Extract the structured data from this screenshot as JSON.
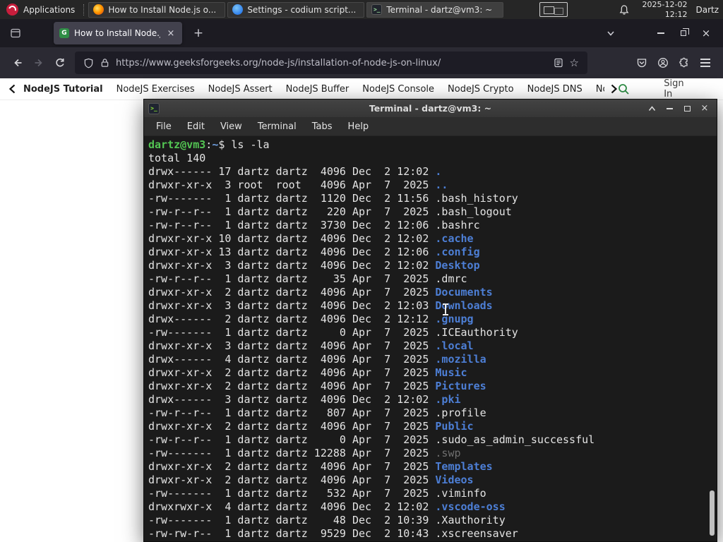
{
  "panel": {
    "applications": "Applications",
    "tasks": [
      {
        "title": "How to Install Node.js o...",
        "icon": "firefox-icon"
      },
      {
        "title": "Settings - codium script...",
        "icon": "codium-icon"
      },
      {
        "title": "Terminal - dartz@vm3: ~",
        "icon": "terminal-icon"
      }
    ],
    "date": "2025-12-02",
    "time": "12:12",
    "user": "Dartz"
  },
  "browser": {
    "tab_title": "How to Install Node.js on",
    "tab_close": "×",
    "new_tab": "+",
    "url": "https://www.geeksforgeeks.org/node-js/installation-of-node-js-on-linux/",
    "window_close": "×",
    "star": "☆"
  },
  "gfg": {
    "links": [
      "NodeJS Tutorial",
      "NodeJS Exercises",
      "NodeJS Assert",
      "NodeJS Buffer",
      "NodeJS Console",
      "NodeJS Crypto",
      "NodeJS DNS",
      "Node"
    ],
    "sign_in": "Sign In"
  },
  "terminal": {
    "title": "Terminal - dartz@vm3: ~",
    "icon_glyph": ">_",
    "menu": [
      "File",
      "Edit",
      "View",
      "Terminal",
      "Tabs",
      "Help"
    ],
    "close": "×",
    "prompt_user_host": "dartz@vm3",
    "prompt_colon": ":",
    "prompt_path": "~",
    "prompt_dollar": "$ ",
    "command": "ls -la",
    "total": "total 140",
    "lines": [
      {
        "pre": "drwx------ 17 dartz dartz  4096 Dec  2 12:02 ",
        "name": ".",
        "type": "dir"
      },
      {
        "pre": "drwxr-xr-x  3 root  root   4096 Apr  7  2025 ",
        "name": "..",
        "type": "dir"
      },
      {
        "pre": "-rw-------  1 dartz dartz  1120 Dec  2 11:56 ",
        "name": ".bash_history",
        "type": "file"
      },
      {
        "pre": "-rw-r--r--  1 dartz dartz   220 Apr  7  2025 ",
        "name": ".bash_logout",
        "type": "file"
      },
      {
        "pre": "-rw-r--r--  1 dartz dartz  3730 Dec  2 12:06 ",
        "name": ".bashrc",
        "type": "file"
      },
      {
        "pre": "drwxr-xr-x 10 dartz dartz  4096 Dec  2 12:02 ",
        "name": ".cache",
        "type": "dir"
      },
      {
        "pre": "drwxr-xr-x 13 dartz dartz  4096 Dec  2 12:06 ",
        "name": ".config",
        "type": "dir"
      },
      {
        "pre": "drwxr-xr-x  3 dartz dartz  4096 Dec  2 12:02 ",
        "name": "Desktop",
        "type": "dir"
      },
      {
        "pre": "-rw-r--r--  1 dartz dartz    35 Apr  7  2025 ",
        "name": ".dmrc",
        "type": "file"
      },
      {
        "pre": "drwxr-xr-x  2 dartz dartz  4096 Apr  7  2025 ",
        "name": "Documents",
        "type": "dir"
      },
      {
        "pre": "drwxr-xr-x  3 dartz dartz  4096 Dec  2 12:03 ",
        "name": "Downloads",
        "type": "dir"
      },
      {
        "pre": "drwx------  2 dartz dartz  4096 Dec  2 12:12 ",
        "name": ".gnupg",
        "type": "dir"
      },
      {
        "pre": "-rw-------  1 dartz dartz     0 Apr  7  2025 ",
        "name": ".ICEauthority",
        "type": "file"
      },
      {
        "pre": "drwxr-xr-x  3 dartz dartz  4096 Apr  7  2025 ",
        "name": ".local",
        "type": "dir"
      },
      {
        "pre": "drwx------  4 dartz dartz  4096 Apr  7  2025 ",
        "name": ".mozilla",
        "type": "dir"
      },
      {
        "pre": "drwxr-xr-x  2 dartz dartz  4096 Apr  7  2025 ",
        "name": "Music",
        "type": "dir"
      },
      {
        "pre": "drwxr-xr-x  2 dartz dartz  4096 Apr  7  2025 ",
        "name": "Pictures",
        "type": "dir"
      },
      {
        "pre": "drwx------  3 dartz dartz  4096 Dec  2 12:02 ",
        "name": ".pki",
        "type": "dir"
      },
      {
        "pre": "-rw-r--r--  1 dartz dartz   807 Apr  7  2025 ",
        "name": ".profile",
        "type": "file"
      },
      {
        "pre": "drwxr-xr-x  2 dartz dartz  4096 Apr  7  2025 ",
        "name": "Public",
        "type": "dir"
      },
      {
        "pre": "-rw-r--r--  1 dartz dartz     0 Apr  7  2025 ",
        "name": ".sudo_as_admin_successful",
        "type": "file"
      },
      {
        "pre": "-rw-------  1 dartz dartz 12288 Apr  7  2025 ",
        "name": ".swp",
        "type": "dim"
      },
      {
        "pre": "drwxr-xr-x  2 dartz dartz  4096 Apr  7  2025 ",
        "name": "Templates",
        "type": "dir"
      },
      {
        "pre": "drwxr-xr-x  2 dartz dartz  4096 Apr  7  2025 ",
        "name": "Videos",
        "type": "dir"
      },
      {
        "pre": "-rw-------  1 dartz dartz   532 Apr  7  2025 ",
        "name": ".viminfo",
        "type": "file"
      },
      {
        "pre": "drwxrwxr-x  4 dartz dartz  4096 Dec  2 12:02 ",
        "name": ".vscode-oss",
        "type": "dir"
      },
      {
        "pre": "-rw-------  1 dartz dartz    48 Dec  2 10:39 ",
        "name": ".Xauthority",
        "type": "file"
      },
      {
        "pre": "-rw-rw-r--  1 dartz dartz  9529 Dec  2 10:43 ",
        "name": ".xscreensaver",
        "type": "file"
      }
    ]
  }
}
